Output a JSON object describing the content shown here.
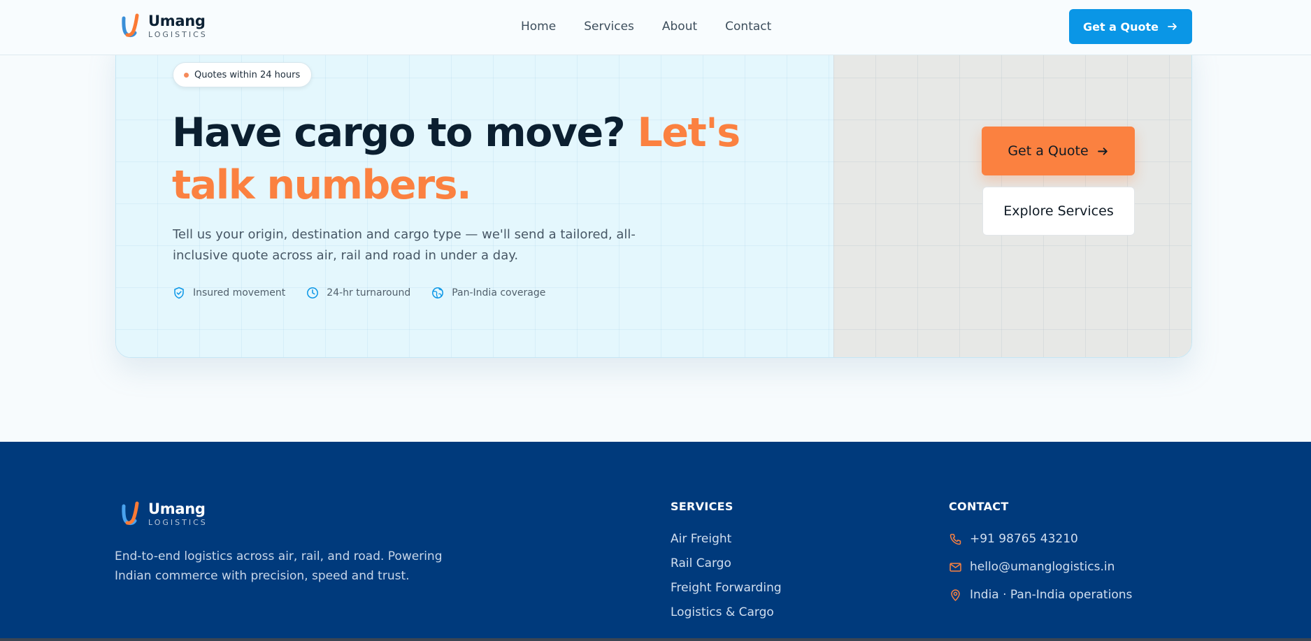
{
  "header": {
    "brand_name": "Umang",
    "brand_sub": "LOGISTICS",
    "nav": [
      "Home",
      "Services",
      "About",
      "Contact"
    ],
    "cta_label": "Get a Quote"
  },
  "hero": {
    "badge": "Quotes within 24 hours",
    "headline_main": "Have cargo to move? ",
    "headline_accent": "Let's talk numbers.",
    "description": "Tell us your origin, destination and cargo type — we'll send a tailored, all-inclusive quote across air, rail and road in under a day.",
    "features": [
      {
        "icon": "shield-check-icon",
        "label": "Insured movement"
      },
      {
        "icon": "clock-icon",
        "label": "24-hr turnaround"
      },
      {
        "icon": "globe-icon",
        "label": "Pan-India coverage"
      }
    ],
    "primary_cta": "Get a Quote",
    "secondary_cta": "Explore Services"
  },
  "footer": {
    "brand_name": "Umang",
    "brand_sub": "LOGISTICS",
    "description": "End-to-end logistics across air, rail, and road. Powering Indian commerce with precision, speed and trust.",
    "services_title": "SERVICES",
    "services": [
      "Air Freight",
      "Rail Cargo",
      "Freight Forwarding",
      "Logistics & Cargo"
    ],
    "contact_title": "CONTACT",
    "contact": [
      {
        "icon": "phone-icon",
        "text": "+91 98765 43210"
      },
      {
        "icon": "mail-icon",
        "text": "hello@umanglogistics.in"
      },
      {
        "icon": "map-pin-icon",
        "text": "India · Pan-India operations"
      }
    ]
  },
  "colors": {
    "brand_blue": "#0a96e6",
    "accent_orange": "#fb8140",
    "footer_navy": "#003a7c",
    "heading_dark": "#0b1f30"
  }
}
